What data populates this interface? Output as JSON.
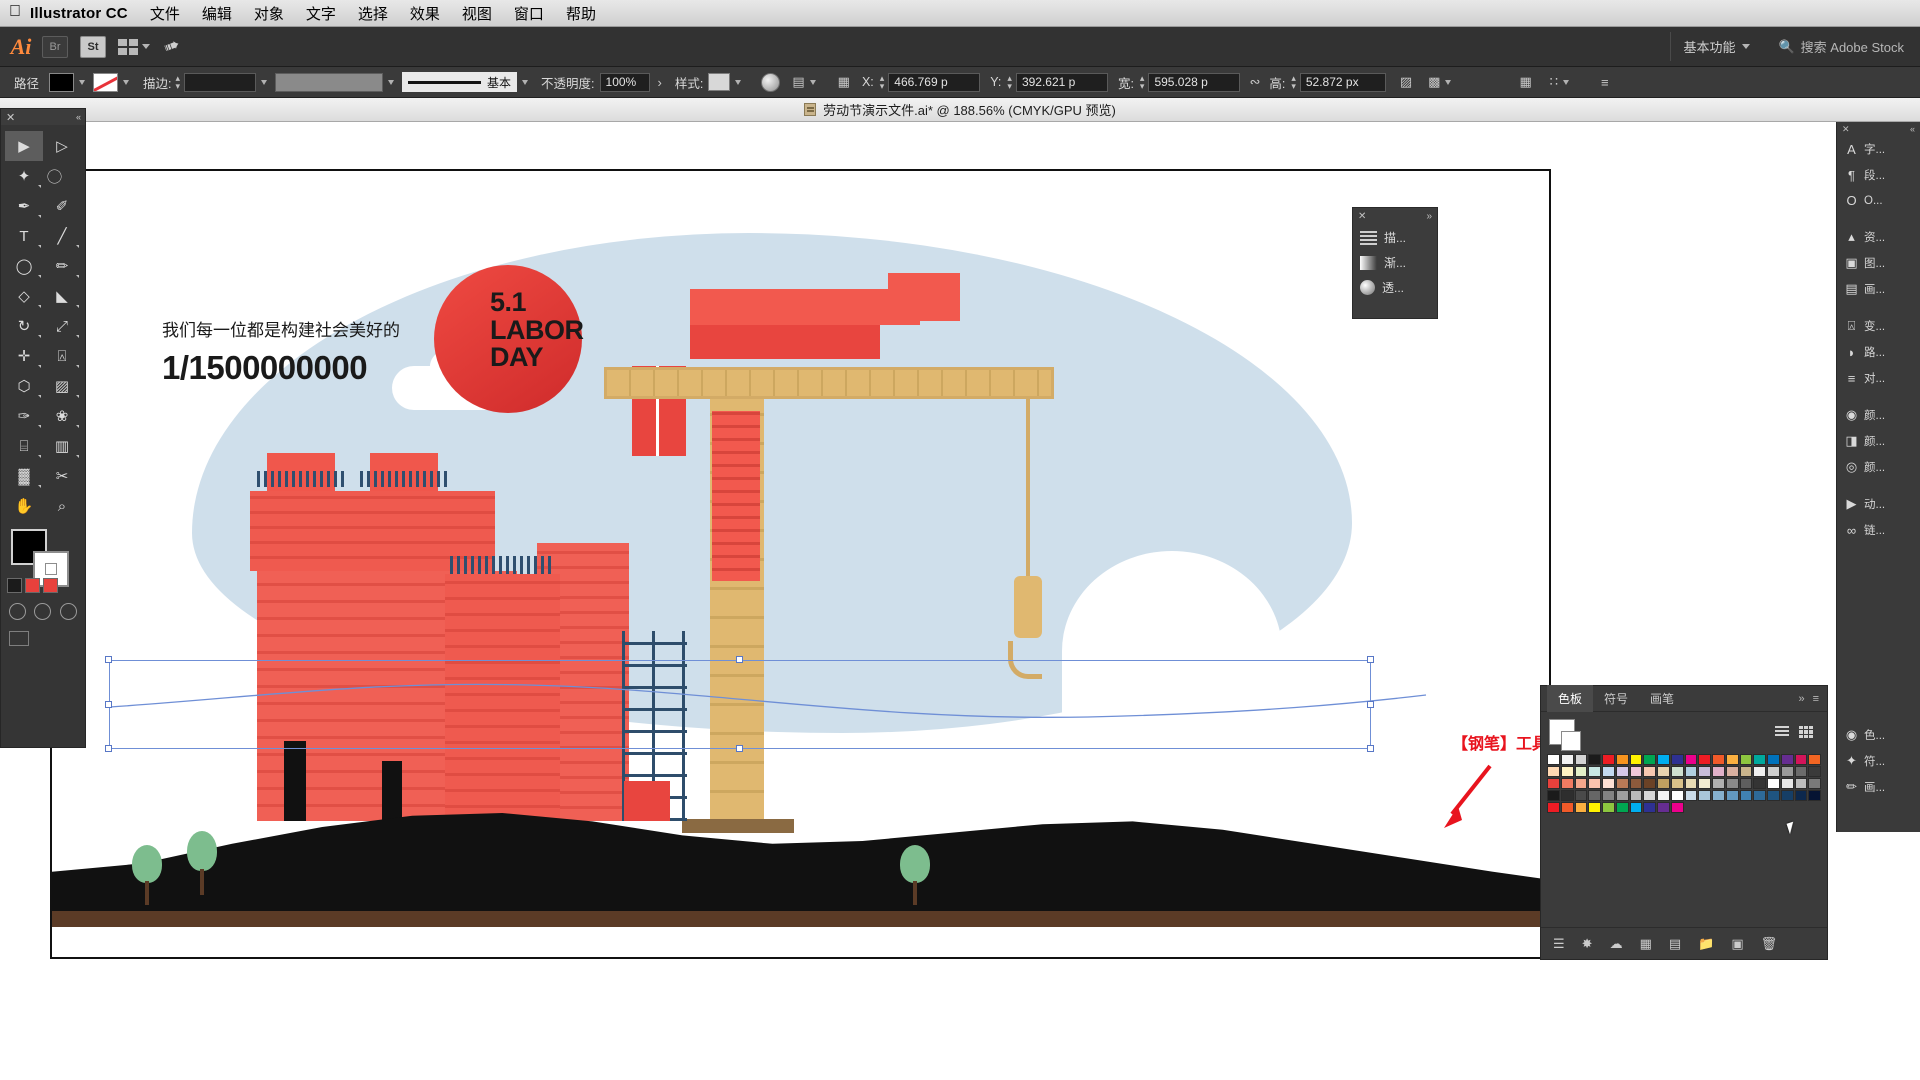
{
  "menubar": {
    "apple_icon": "apple-icon",
    "app_name": "Illustrator CC",
    "items": [
      "文件",
      "编辑",
      "对象",
      "文字",
      "选择",
      "效果",
      "视图",
      "窗口",
      "帮助"
    ]
  },
  "appbar": {
    "logo": "Ai",
    "bridge_label": "Br",
    "stock_label": "St",
    "arrange_label": "arrange-documents-icon",
    "rocket_label": "rocket-icon",
    "workspace": "基本功能",
    "search_placeholder": "搜索 Adobe Stock",
    "search_value": "搜索 Adobe Stock"
  },
  "controlbar": {
    "object_type": "路径",
    "fill_label": "fill-swatch",
    "stroke_label": "stroke-swatch",
    "stroke_weight_label": "描边:",
    "stroke_weight_value": "",
    "profile_label": "基本",
    "opacity_label": "不透明度:",
    "opacity_value": "100%",
    "style_label": "样式:",
    "x_label": "X:",
    "x_value": "466.769 p",
    "y_label": "Y:",
    "y_value": "392.621 p",
    "w_label": "宽:",
    "w_value": "595.028 p",
    "h_label": "高:",
    "h_value": "52.872 px",
    "lock_ratio": "link-ratio-icon",
    "transform_icon": "transform-icon",
    "align_icon": "align-icon",
    "distribute_icon": "distribute-icon",
    "options_icon": "panel-options-icon"
  },
  "document_tab": {
    "icon": "ai-file-icon",
    "title": "劳动节演示文件.ai* @ 188.56% (CMYK/GPU 预览)"
  },
  "toolbar": {
    "close_icon": "close-icon",
    "collapse_icon": "double-chevron-icon",
    "tools": [
      {
        "name": "selection-tool",
        "glyph": "▶",
        "selected": true
      },
      {
        "name": "direct-selection-tool",
        "glyph": "▷",
        "selected": false
      },
      {
        "name": "magic-wand-tool",
        "glyph": "✦",
        "selected": false
      },
      {
        "name": "lasso-tool",
        "glyph": "◠",
        "selected": false
      },
      {
        "name": "pen-tool",
        "glyph": "✒",
        "selected": false
      },
      {
        "name": "curvature-tool",
        "glyph": "✐",
        "selected": false
      },
      {
        "name": "type-tool",
        "glyph": "T",
        "selected": false
      },
      {
        "name": "line-segment-tool",
        "glyph": "╱",
        "selected": false
      },
      {
        "name": "ellipse-tool",
        "glyph": "◯",
        "selected": false
      },
      {
        "name": "paintbrush-tool",
        "glyph": "🖌",
        "selected": false
      },
      {
        "name": "shaper-tool",
        "glyph": "◇",
        "selected": false
      },
      {
        "name": "eraser-tool",
        "glyph": "◣",
        "selected": false
      },
      {
        "name": "rotate-tool",
        "glyph": "↻",
        "selected": false
      },
      {
        "name": "scale-tool",
        "glyph": "⤢",
        "selected": false
      },
      {
        "name": "width-tool",
        "glyph": "✛",
        "selected": false
      },
      {
        "name": "free-transform-tool",
        "glyph": "⌗",
        "selected": false
      },
      {
        "name": "shape-builder-tool",
        "glyph": "⬡",
        "selected": false
      },
      {
        "name": "gradient-tool",
        "glyph": "▨",
        "selected": false
      },
      {
        "name": "eyedropper-tool",
        "glyph": "✎",
        "selected": false
      },
      {
        "name": "blend-tool",
        "glyph": "❀",
        "selected": false
      },
      {
        "name": "symbol-sprayer-tool",
        "glyph": "⌸",
        "selected": false
      },
      {
        "name": "column-graph-tool",
        "glyph": "▥",
        "selected": false
      },
      {
        "name": "artboard-tool",
        "glyph": "⬓",
        "selected": false
      },
      {
        "name": "slice-tool",
        "glyph": "✂",
        "selected": false
      },
      {
        "name": "hand-tool",
        "glyph": "✋",
        "selected": false
      },
      {
        "name": "zoom-tool",
        "glyph": "⌕",
        "selected": false
      }
    ],
    "fill_color": "#000000",
    "stroke_color": "#ffffff",
    "mini_swatches": [
      "#1b1b1b",
      "#e8413c",
      "#e8413c"
    ],
    "screen_modes": [
      "normal-screen-mode",
      "full-screen-menu-mode",
      "full-screen-mode"
    ],
    "draw_modes": [
      "draw-normal",
      "draw-behind",
      "draw-inside"
    ]
  },
  "appearance_panel": {
    "close_icon": "close-icon",
    "expand_icon": "double-chevron-icon",
    "rows": [
      {
        "icon": "stroke-icon",
        "label": "描..."
      },
      {
        "icon": "gradient-icon",
        "label": "渐..."
      },
      {
        "icon": "transparency-icon",
        "label": "透..."
      }
    ]
  },
  "right_dock": {
    "close_icon": "close-icon",
    "items": [
      {
        "icon": "character-icon",
        "glyph": "A",
        "label": "字..."
      },
      {
        "icon": "paragraph-icon",
        "glyph": "¶",
        "label": "段..."
      },
      {
        "icon": "opentype-icon",
        "glyph": "O",
        "label": "O..."
      },
      {
        "icon": "asset-export-icon",
        "glyph": "⬔",
        "label": "资..."
      },
      {
        "icon": "layers-icon",
        "glyph": "◳",
        "label": "图..."
      },
      {
        "icon": "artboards-icon",
        "glyph": "▤",
        "label": "画..."
      },
      {
        "icon": "transform-icon",
        "glyph": "⌗",
        "label": "变..."
      },
      {
        "icon": "pathfinder-icon",
        "glyph": "◧",
        "label": "路..."
      },
      {
        "icon": "align-icon",
        "glyph": "≡",
        "label": "对..."
      },
      {
        "icon": "color-icon",
        "glyph": "◕",
        "label": "颜..."
      },
      {
        "icon": "color-guide-icon",
        "glyph": "◨",
        "label": "颜..."
      },
      {
        "icon": "recolor-icon",
        "glyph": "◎",
        "label": "颜..."
      },
      {
        "icon": "actions-icon",
        "glyph": "▶",
        "label": "动..."
      },
      {
        "icon": "links-icon",
        "glyph": "⛓",
        "label": "链..."
      }
    ],
    "secondary_items": [
      {
        "icon": "color-icon",
        "glyph": "◕",
        "label": "色..."
      },
      {
        "icon": "symbols-icon",
        "glyph": "✦",
        "label": "符..."
      },
      {
        "icon": "brushes-icon",
        "glyph": "🖌",
        "label": "画..."
      }
    ]
  },
  "swatches_panel": {
    "tabs": [
      "色板",
      "符号",
      "画笔"
    ],
    "active_tab": "色板",
    "expand_icon": "double-chevron-icon",
    "menu_icon": "panel-menu-icon",
    "view_list_icon": "list-view-icon",
    "view_grid_icon": "grid-view-icon",
    "footer_icons": [
      "swatch-libraries-icon",
      "show-swatch-kinds-icon",
      "swatch-options-icon",
      "new-color-group-icon",
      "new-swatch-icon",
      "folder-icon",
      "duplicate-icon",
      "delete-swatch-icon"
    ],
    "colors": [
      "#ffffff",
      "#f2f2f2",
      "#d4d4d4",
      "#1b1b1b",
      "#ed1c24",
      "#f7941e",
      "#fff200",
      "#00a651",
      "#00aeef",
      "#2e3192",
      "#ec008c",
      "#ed1c24",
      "#f15a29",
      "#fbb040",
      "#8dc63f",
      "#00a99d",
      "#0072bc",
      "#662d91",
      "#d4145a",
      "#f26522",
      "#ffd9b3",
      "#fff3c4",
      "#e4f0c8",
      "#c8e8e4",
      "#c3d9f0",
      "#d6c8e8",
      "#f0c8d9",
      "#f7c8b0",
      "#e8d4b0",
      "#cfe0cf",
      "#b0cfe0",
      "#c8bcd9",
      "#e0b0c8",
      "#d9b0a0",
      "#c9b48c",
      "#efefef",
      "#cfcfcf",
      "#9a9a9a",
      "#6b6b6b",
      "#3a3a3a",
      "#e8413c",
      "#f07b62",
      "#f5a78c",
      "#fac3ae",
      "#fde0d4",
      "#b97a57",
      "#8c5a3c",
      "#6b4226",
      "#c0a060",
      "#d9c28a",
      "#e8dcb4",
      "#f2ecd2",
      "#b0b0b0",
      "#8a8a8a",
      "#5e5e5e",
      "#343434",
      "#ffffff",
      "#e6e6e6",
      "#bdbdbd",
      "#7a7a7a",
      "#1b1b1b",
      "#2e2e2e",
      "#4a4a4a",
      "#666666",
      "#828282",
      "#9e9e9e",
      "#bababa",
      "#d6d6d6",
      "#f2f2f2",
      "#ffffff",
      "#c9dbe8",
      "#a9c6da",
      "#86b0cd",
      "#6399c0",
      "#4082b3",
      "#2e6a99",
      "#1f5480",
      "#163e66",
      "#0d284d",
      "#061433",
      "#ed1c24",
      "#f15a29",
      "#fbb040",
      "#fff200",
      "#8dc63f",
      "#00a651",
      "#00aeef",
      "#2e3192",
      "#662d91",
      "#ec008c"
    ]
  },
  "annotation": {
    "text": "【钢笔】工具",
    "color": "#e8141e"
  },
  "artwork": {
    "headline_small": "我们每一位都是构建社会美好的",
    "headline_big": "1/1500000000",
    "badge_line1": "5.1",
    "badge_line2": "LABOR",
    "badge_line3": "DAY",
    "sun_color": "#e8413c",
    "sky_color": "#cfdfeb",
    "building_color": "#e8554d",
    "crane_color": "#e0b870",
    "ground_color": "#111111",
    "road_color": "#5b3b26",
    "tree_color": "#7dbd8e"
  }
}
